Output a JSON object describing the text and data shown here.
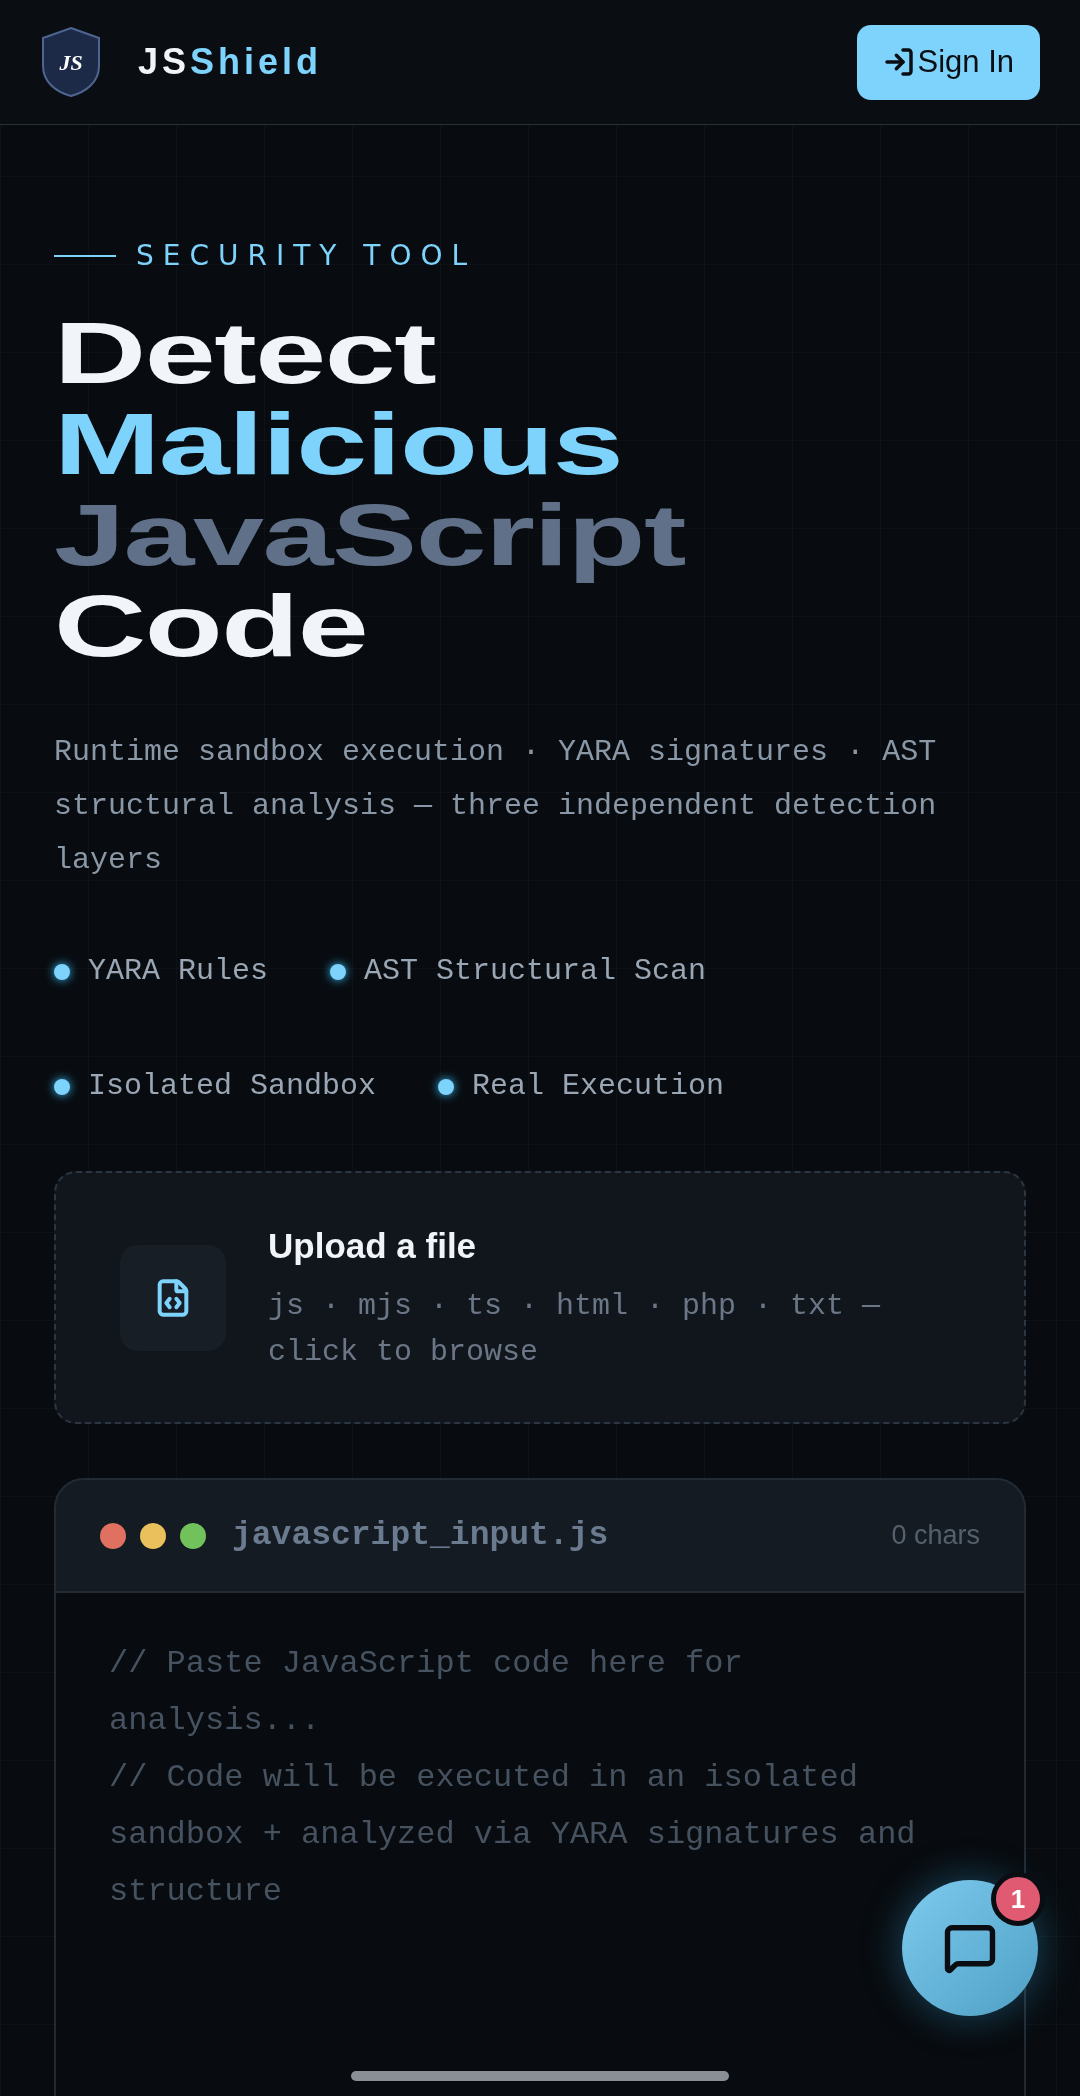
{
  "header": {
    "logo_badge": "JS",
    "brand_prefix": "JS",
    "brand_suffix": "Shield",
    "sign_in": "Sign In"
  },
  "hero": {
    "eyebrow": "SECURITY TOOL",
    "title_lines": [
      {
        "text": "Detect",
        "color": "#f1f5f9"
      },
      {
        "text": "Malicious",
        "color": "#7dd3fc"
      },
      {
        "text": "JavaScript",
        "color": "#5f7088"
      },
      {
        "text": "Code",
        "color": "#f1f5f9"
      }
    ],
    "description": "Runtime sandbox execution · YARA signatures · AST structural analysis — three independent detection layers",
    "features": [
      "YARA Rules",
      "AST Structural Scan",
      "Isolated Sandbox",
      "Real Execution"
    ]
  },
  "upload": {
    "title": "Upload a file",
    "hint": "js · mjs · ts · html · php · txt — click to browse"
  },
  "editor": {
    "window_dots": [
      {
        "color": "#e0705f"
      },
      {
        "color": "#e9c05c"
      },
      {
        "color": "#72c25c"
      }
    ],
    "filename": "javascript_input.js",
    "char_count": "0 chars",
    "placeholder": "// Paste JavaScript code here for analysis...\n// Code will be executed in an isolated sandbox + analyzed via YARA signatures and structure"
  },
  "chat": {
    "badge": "1"
  }
}
